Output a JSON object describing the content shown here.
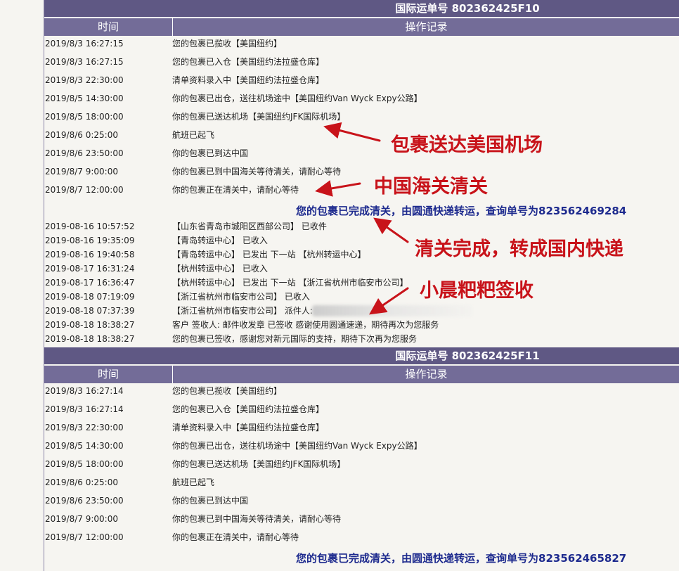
{
  "sections": [
    {
      "title": "国际运单号 802362425F10",
      "headers": [
        "时间",
        "操作记录"
      ],
      "rows": [
        {
          "t": "2019/8/3 16:27:15",
          "d": "您的包裹已揽收【美国纽约】"
        },
        {
          "t": "2019/8/3 16:27:15",
          "d": "您的包裹已入仓【美国纽约法拉盛仓库】"
        },
        {
          "t": "2019/8/3 22:30:00",
          "d": "清单资料录入中【美国纽约法拉盛仓库】"
        },
        {
          "t": "2019/8/5 14:30:00",
          "d": "你的包裹已出仓，送往机场途中【美国纽约Van Wyck Expy公路】"
        },
        {
          "t": "2019/8/5 18:00:00",
          "d": "你的包裹已送达机场【美国纽约JFK国际机场】"
        },
        {
          "t": "2019/8/6 0:25:00",
          "d": "航班已起飞"
        },
        {
          "t": "2019/8/6 23:50:00",
          "d": "你的包裹已到达中国"
        },
        {
          "t": "2019/8/7 9:00:00",
          "d": "你的包裹已到中国海关等待清关，请耐心等待"
        },
        {
          "t": "2019/8/7 12:00:00",
          "d": "你的包裹正在清关中，请耐心等待"
        }
      ],
      "notice": "您的包裹已完成清关，由圆通快递转运，查询单号为823562469284",
      "domestic": [
        {
          "t": "2019-08-16 10:57:52",
          "d": "【山东省青岛市城阳区西部公司】 已收件"
        },
        {
          "t": "2019-08-16 19:35:09",
          "d": "【青岛转运中心】 已收入"
        },
        {
          "t": "2019-08-16 19:40:58",
          "d": "【青岛转运中心】 已发出 下一站 【杭州转运中心】"
        },
        {
          "t": "2019-08-17 16:31:24",
          "d": "【杭州转运中心】 已收入"
        },
        {
          "t": "2019-08-17 16:36:47",
          "d": "【杭州转运中心】 已发出 下一站 【浙江省杭州市临安市公司】"
        },
        {
          "t": "2019-08-18 07:19:09",
          "d": "【浙江省杭州市临安市公司】 已收入"
        },
        {
          "t": "2019-08-18 07:37:39",
          "d": "【浙江省杭州市临安市公司】 派件人:"
        },
        {
          "t": "2019-08-18 18:38:27",
          "d": "客户 签收人: 邮件收发章 已签收 感谢使用圆通速递，期待再次为您服务"
        },
        {
          "t": "2019-08-18 18:38:27",
          "d": "您的包裹已签收，感谢您对新元国际的支持，期待下次再为您服务"
        }
      ]
    },
    {
      "title": "国际运单号 802362425F11",
      "headers": [
        "时间",
        "操作记录"
      ],
      "rows": [
        {
          "t": "2019/8/3 16:27:14",
          "d": "您的包裹已揽收【美国纽约】"
        },
        {
          "t": "2019/8/3 16:27:14",
          "d": "您的包裹已入仓【美国纽约法拉盛仓库】"
        },
        {
          "t": "2019/8/3 22:30:00",
          "d": "清单资料录入中【美国纽约法拉盛仓库】"
        },
        {
          "t": "2019/8/5 14:30:00",
          "d": "你的包裹已出仓，送往机场途中【美国纽约Van Wyck Expy公路】"
        },
        {
          "t": "2019/8/5 18:00:00",
          "d": "你的包裹已送达机场【美国纽约JFK国际机场】"
        },
        {
          "t": "2019/8/6 0:25:00",
          "d": "航班已起飞"
        },
        {
          "t": "2019/8/6 23:50:00",
          "d": "你的包裹已到达中国"
        },
        {
          "t": "2019/8/7 9:00:00",
          "d": "你的包裹已到中国海关等待清关，请耐心等待"
        },
        {
          "t": "2019/8/7 12:00:00",
          "d": "你的包裹正在清关中，请耐心等待"
        }
      ],
      "notice": "您的包裹已完成清关，由圆通快递转运，查询单号为823562465827"
    }
  ],
  "annotations": {
    "airport": "包裹送达美国机场",
    "customs": "中国海关清关",
    "cleared": "清关完成，转成国内快递",
    "signed": "小晨粑粑签收"
  },
  "colors": {
    "title_bar": "#5f5884",
    "header_row": "#736c98",
    "notice": "#1d2a8e",
    "annotation": "#c8131a"
  }
}
